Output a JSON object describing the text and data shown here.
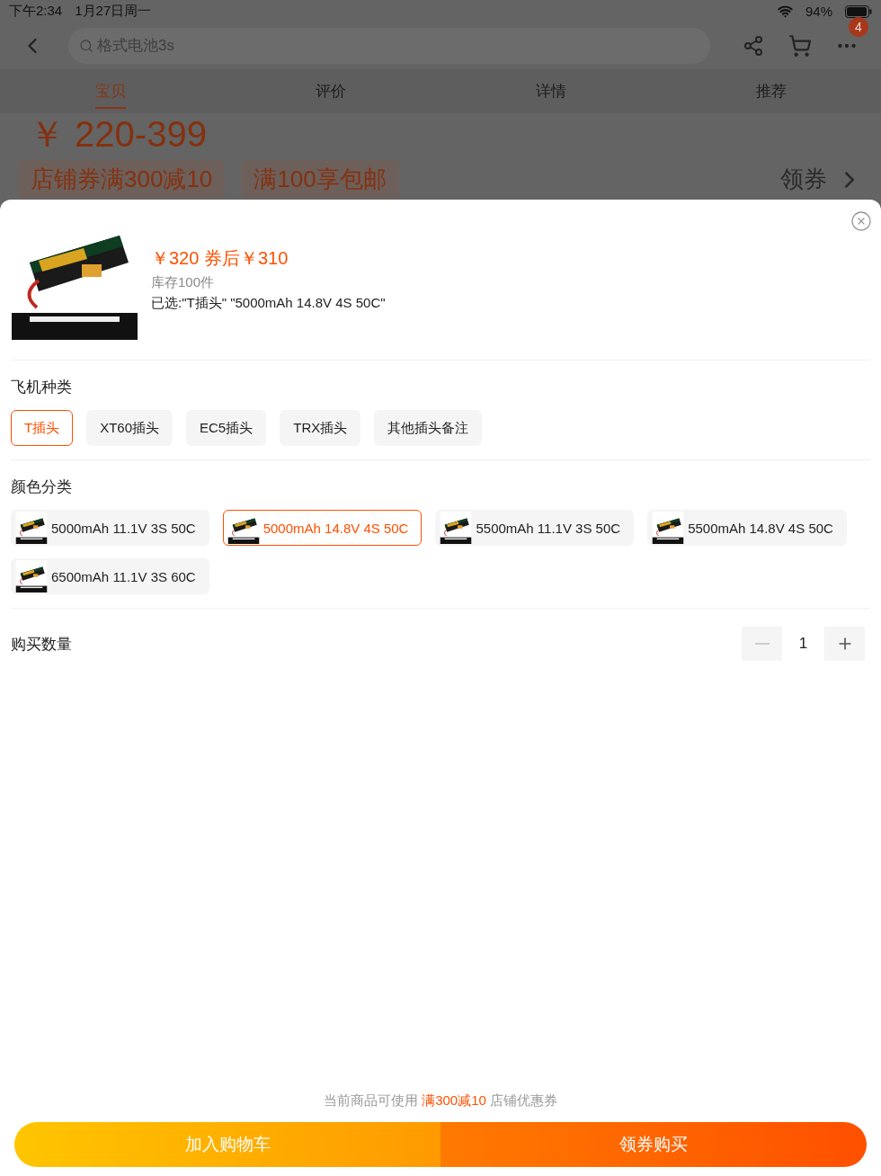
{
  "status_bar": {
    "time": "下午2:34",
    "date": "1月27日周一",
    "battery": "94%"
  },
  "nav": {
    "search": {
      "placeholder": "格式电池3s"
    },
    "badge": "4"
  },
  "tabs": [
    {
      "label": "宝贝",
      "selected": true
    },
    {
      "label": "评价",
      "selected": false
    },
    {
      "label": "详情",
      "selected": false
    },
    {
      "label": "推荐",
      "selected": false
    }
  ],
  "background": {
    "price": "￥ 220-399",
    "coupons": [
      "店铺券满300减10",
      "满100享包邮"
    ],
    "coupon_link": "领券"
  },
  "sheet": {
    "price": "￥320 券后￥310",
    "stock": "库存100件",
    "selected_summary": "已选:\"T插头\" \"5000mAh 14.8V 4S 50C\"",
    "groups": [
      {
        "title": "飞机种类",
        "kind": "text",
        "options": [
          {
            "label": "T插头",
            "selected": true
          },
          {
            "label": "XT60插头",
            "selected": false
          },
          {
            "label": "EC5插头",
            "selected": false
          },
          {
            "label": "TRX插头",
            "selected": false
          },
          {
            "label": "其他插头备注",
            "selected": false
          }
        ]
      },
      {
        "title": "颜色分类",
        "kind": "thumb",
        "options": [
          {
            "label": "5000mAh 11.1V 3S 50C",
            "selected": false
          },
          {
            "label": "5000mAh 14.8V 4S 50C",
            "selected": true
          },
          {
            "label": "5500mAh 11.1V 3S 50C",
            "selected": false
          },
          {
            "label": "5500mAh 14.8V 4S 50C",
            "selected": false
          },
          {
            "label": "6500mAh 11.1V 3S 60C",
            "selected": false
          }
        ]
      }
    ],
    "quantity": {
      "label": "购买数量",
      "value": "1"
    },
    "coupon_note": "当前商品可使用 **满300减10** 店铺优惠券",
    "buttons": [
      {
        "label": "加入购物车",
        "kind": "cart"
      },
      {
        "label": "领券购买",
        "kind": "buy"
      }
    ]
  }
}
